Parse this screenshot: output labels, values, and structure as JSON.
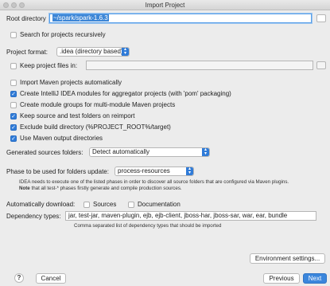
{
  "window": {
    "title": "Import Project"
  },
  "root_directory": {
    "label": "Root directory",
    "value": "~/spark/spark-1.6.3"
  },
  "search_recursively": {
    "label": "Search for projects recursively",
    "checked": false
  },
  "project_format": {
    "label": "Project format:",
    "value": ".idea (directory based)"
  },
  "keep_project_files": {
    "label": "Keep project files in:",
    "checked": false,
    "value": ""
  },
  "options": [
    {
      "label": "Import Maven projects automatically",
      "checked": false
    },
    {
      "label": "Create IntelliJ IDEA modules for aggregator projects (with 'pom' packaging)",
      "checked": true
    },
    {
      "label": "Create module groups for multi-module Maven projects",
      "checked": false
    },
    {
      "label": "Keep source and test folders on reimport",
      "checked": true
    },
    {
      "label": "Exclude build directory (%PROJECT_ROOT%/target)",
      "checked": true
    },
    {
      "label": "Use Maven output directories",
      "checked": true
    }
  ],
  "generated_sources": {
    "label": "Generated sources folders:",
    "value": "Detect automatically"
  },
  "phase": {
    "label": "Phase to be used for folders update:",
    "value": "process-resources"
  },
  "phase_note": {
    "line1": "IDEA needs to execute one of the listed phases in order to discover all source folders that are configured via Maven plugins.",
    "note_bold": "Note",
    "line2": " that all test-* phases firstly generate and compile production sources."
  },
  "auto_download": {
    "label": "Automatically download:",
    "sources": "Sources",
    "documentation": "Documentation",
    "sources_checked": false,
    "documentation_checked": false
  },
  "dependency_types": {
    "label": "Dependency types:",
    "value": "jar, test-jar, maven-plugin, ejb, ejb-client, jboss-har, jboss-sar, war, ear, bundle",
    "hint": "Comma separated list of dependency types that should be imported"
  },
  "buttons": {
    "environment": "Environment settings...",
    "help": "?",
    "cancel": "Cancel",
    "previous": "Previous",
    "next": "Next"
  },
  "colors": {
    "accent": "#2f7bd8",
    "primary_button": "#3b86dc",
    "background": "#ececec"
  }
}
